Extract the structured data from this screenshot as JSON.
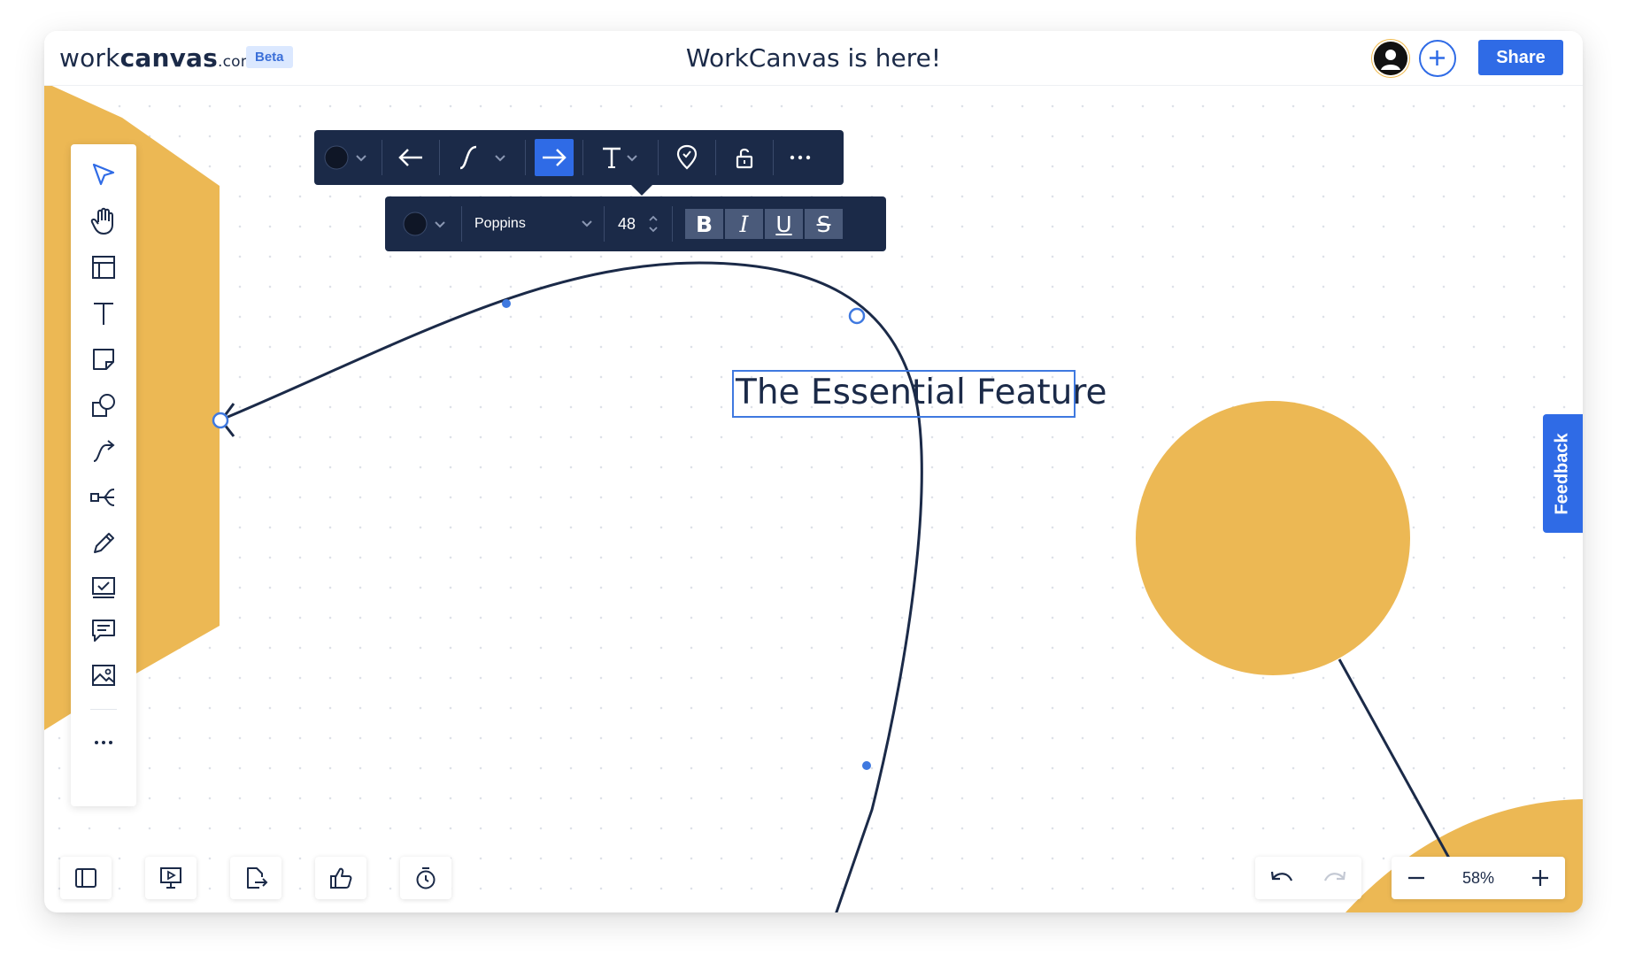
{
  "header": {
    "logo_light": "work",
    "logo_bold": "canvas",
    "logo_suffix": ".com",
    "badge": "Beta",
    "title": "WorkCanvas is here!",
    "share_label": "Share"
  },
  "canvas": {
    "text_element": "The Essential Feature",
    "shape_color": "#ECB854",
    "line_color": "#1B2A48",
    "selection_color": "#3F79E0"
  },
  "toolbar_main": {
    "items": [
      "color-picker",
      "arrow-start",
      "line-style",
      "arrow-end",
      "text",
      "pin",
      "lock",
      "more"
    ]
  },
  "toolbar_text": {
    "font": "Poppins",
    "size": "48",
    "bold": "B",
    "italic": "I",
    "underline": "U",
    "strike": "S"
  },
  "left_toolbar": {
    "items": [
      "select",
      "hand",
      "frame",
      "text",
      "sticky-note",
      "shapes",
      "connector",
      "mind-map",
      "pen",
      "checklist",
      "comment",
      "image",
      "more"
    ]
  },
  "zoom": {
    "level": "58%"
  },
  "feedback_label": "Feedback",
  "colors": {
    "accent": "#2F6BE6",
    "navy": "#1B2A48",
    "shape": "#ECB854"
  }
}
